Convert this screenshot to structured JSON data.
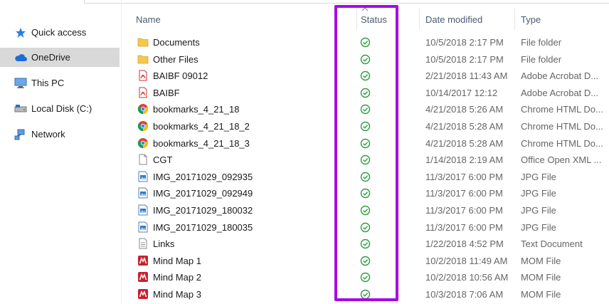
{
  "nav": {
    "items": [
      {
        "label": "Quick access",
        "icon": "star-icon",
        "selected": false
      },
      {
        "label": "OneDrive",
        "icon": "cloud-icon",
        "selected": true
      },
      {
        "label": "This PC",
        "icon": "computer-icon",
        "selected": false
      },
      {
        "label": "Local Disk (C:)",
        "icon": "drive-icon",
        "selected": false
      },
      {
        "label": "Network",
        "icon": "network-icon",
        "selected": false
      }
    ]
  },
  "columns": {
    "name": "Name",
    "status": "Status",
    "date": "Date modified",
    "type": "Type"
  },
  "files": [
    {
      "name": "Documents",
      "date": "10/5/2018 2:17 PM",
      "type": "File folder",
      "icon": "folder-icon"
    },
    {
      "name": "Other Files",
      "date": "10/5/2018 2:17 PM",
      "type": "File folder",
      "icon": "folder-icon"
    },
    {
      "name": "BAIBF 09012",
      "date": "2/21/2018 11:43 AM",
      "type": "Adobe Acrobat D...",
      "icon": "pdf-icon"
    },
    {
      "name": "BAIBF",
      "date": "10/14/2017 12:12",
      "type": "Adobe Acrobat D...",
      "icon": "pdf-icon"
    },
    {
      "name": "bookmarks_4_21_18",
      "date": "4/21/2018 5:26 AM",
      "type": "Chrome HTML Do...",
      "icon": "chrome-icon"
    },
    {
      "name": "bookmarks_4_21_18_2",
      "date": "4/21/2018 5:28 AM",
      "type": "Chrome HTML Do...",
      "icon": "chrome-icon"
    },
    {
      "name": "bookmarks_4_21_18_3",
      "date": "4/21/2018 5:28 AM",
      "type": "Chrome HTML Do...",
      "icon": "chrome-icon"
    },
    {
      "name": "CGT",
      "date": "1/14/2018 2:19 AM",
      "type": "Office Open XML ...",
      "icon": "document-icon"
    },
    {
      "name": "IMG_20171029_092935",
      "date": "11/3/2017 6:00 PM",
      "type": "JPG File",
      "icon": "image-icon"
    },
    {
      "name": "IMG_20171029_092949",
      "date": "11/3/2017 6:00 PM",
      "type": "JPG File",
      "icon": "image-icon"
    },
    {
      "name": "IMG_20171029_180032",
      "date": "11/3/2017 6:00 PM",
      "type": "JPG File",
      "icon": "image-icon"
    },
    {
      "name": "IMG_20171029_180035",
      "date": "11/3/2017 6:00 PM",
      "type": "JPG File",
      "icon": "image-icon"
    },
    {
      "name": "Links",
      "date": "1/22/2018 4:52 PM",
      "type": "Text Document",
      "icon": "text-file-icon"
    },
    {
      "name": "Mind Map 1",
      "date": "10/2/2018 11:49 AM",
      "type": "MOM File",
      "icon": "mindmap-icon"
    },
    {
      "name": "Mind Map 2",
      "date": "10/2/2018 10:56 AM",
      "type": "MOM File",
      "icon": "mindmap-icon"
    },
    {
      "name": "Mind Map 3",
      "date": "10/3/2018 7:06 AM",
      "type": "MOM File",
      "icon": "mindmap-icon"
    }
  ],
  "colors": {
    "highlight": "#a70ae6",
    "status_ok": "#2e9e3e",
    "selected_bg": "#d9d9d9"
  }
}
